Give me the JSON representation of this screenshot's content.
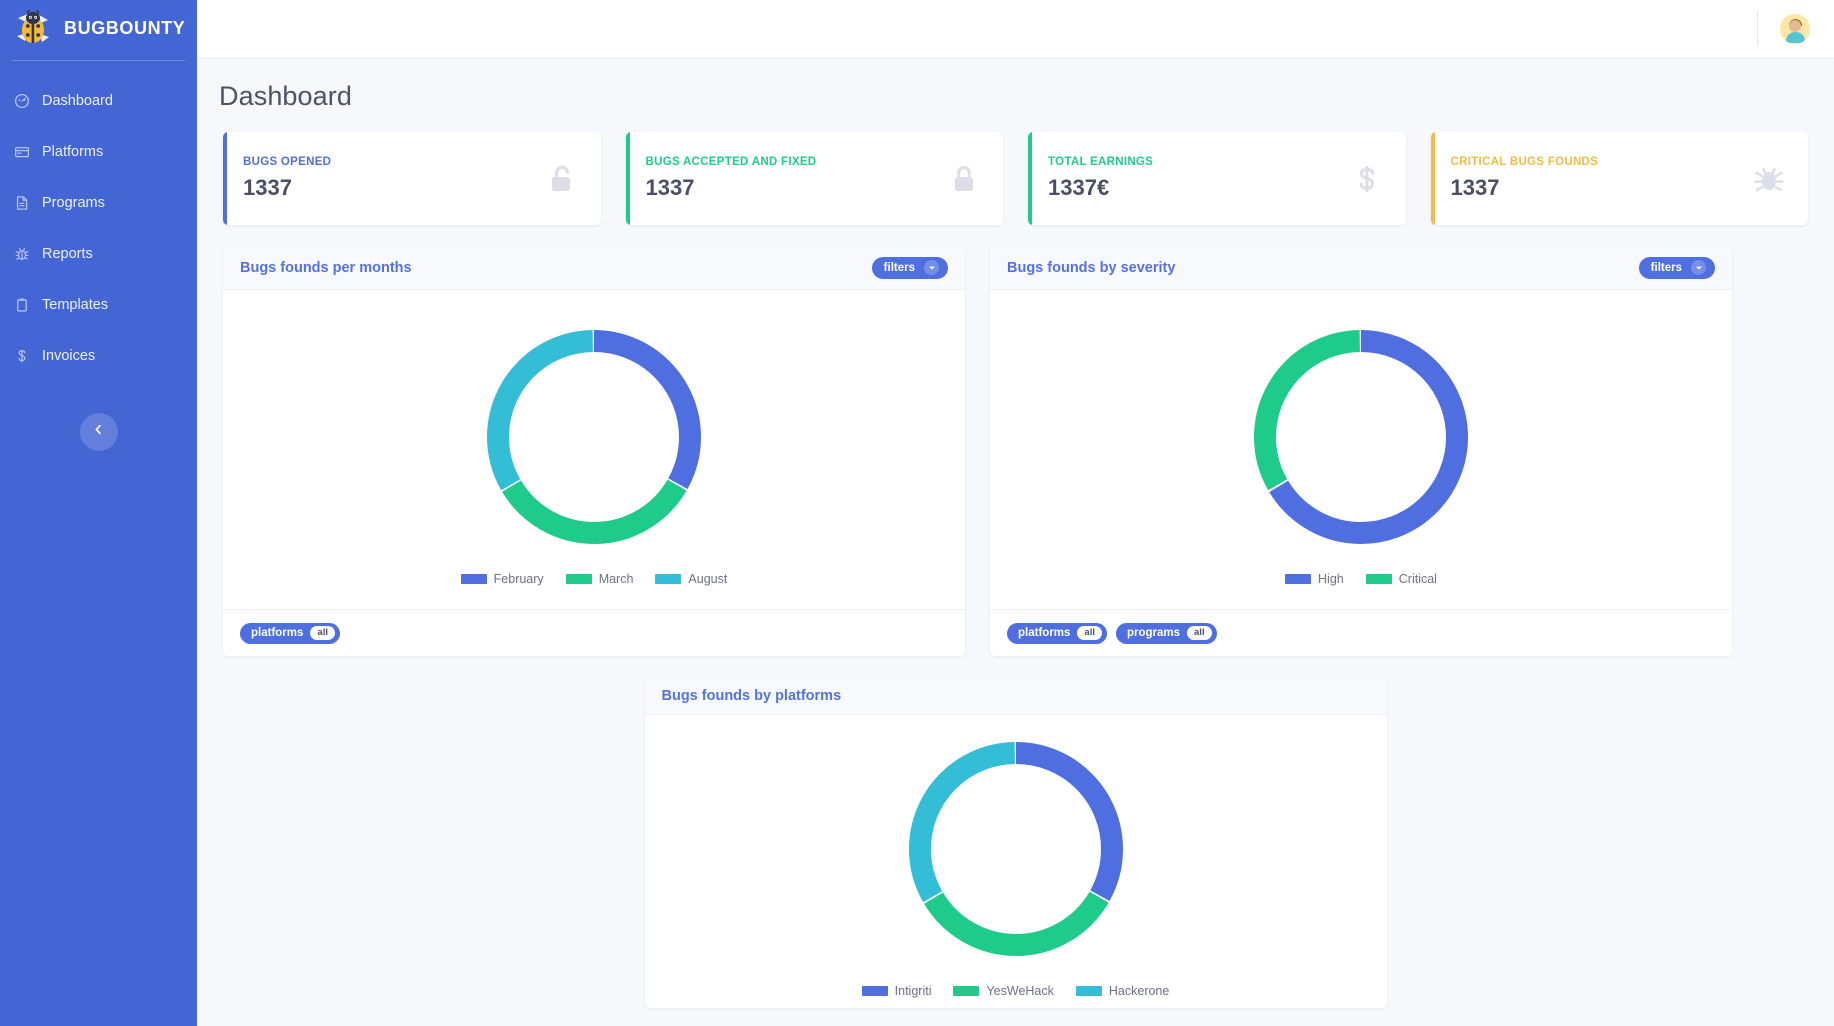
{
  "brand": {
    "name": "BUGBOUNTY",
    "logo_icon": "ladybug-logo-icon"
  },
  "sidebar": {
    "items": [
      {
        "label": "Dashboard",
        "icon": "speedometer-icon"
      },
      {
        "label": "Platforms",
        "icon": "browser-window-icon"
      },
      {
        "label": "Programs",
        "icon": "document-icon"
      },
      {
        "label": "Reports",
        "icon": "bug-icon"
      },
      {
        "label": "Templates",
        "icon": "clipboard-icon"
      },
      {
        "label": "Invoices",
        "icon": "dollar-icon"
      }
    ],
    "collapse_icon": "chevron-left-icon"
  },
  "topbar": {
    "avatar_icon": "user-avatar-icon"
  },
  "page": {
    "title": "Dashboard"
  },
  "stats": [
    {
      "label": "BUGS OPENED",
      "value": "1337",
      "accent": "#4f6fe0",
      "label_color": "#4f6fe0",
      "icon": "unlock-icon"
    },
    {
      "label": "BUGS ACCEPTED AND FIXED",
      "value": "1337",
      "accent": "#1ecb8b",
      "label_color": "#1ecb8b",
      "icon": "lock-icon"
    },
    {
      "label": "TOTAL EARNINGS",
      "value": "1337€",
      "accent": "#1ecb8b",
      "label_color": "#1ecb8b",
      "icon": "dollar-sign-icon"
    },
    {
      "label": "CRITICAL BUGS FOUNDS",
      "value": "1337",
      "accent": "#f3bb45",
      "label_color": "#f3bb45",
      "icon": "bug-icon"
    }
  ],
  "cards": {
    "months": {
      "title": "Bugs founds per months",
      "filters_label": "filters",
      "footer_pills": [
        {
          "label": "platforms",
          "badge": "all"
        }
      ]
    },
    "severity": {
      "title": "Bugs founds by severity",
      "filters_label": "filters",
      "footer_pills": [
        {
          "label": "platforms",
          "badge": "all"
        },
        {
          "label": "programs",
          "badge": "all"
        }
      ]
    },
    "platforms": {
      "title": "Bugs founds by platforms",
      "footer_pills": []
    }
  },
  "chart_data": [
    {
      "type": "pie",
      "id": "bugs-per-months",
      "title": "Bugs founds per months",
      "donut": true,
      "legend_position": "bottom",
      "categories": [
        "February",
        "March",
        "August"
      ],
      "values": [
        33.3,
        33.3,
        33.4
      ],
      "colors": [
        "#4f6fe0",
        "#1ecb8b",
        "#33bdd6"
      ]
    },
    {
      "type": "pie",
      "id": "bugs-by-severity",
      "title": "Bugs founds by severity",
      "donut": true,
      "legend_position": "bottom",
      "categories": [
        "High",
        "Critical"
      ],
      "values": [
        66.7,
        33.3
      ],
      "colors": [
        "#4f6fe0",
        "#1ecb8b"
      ]
    },
    {
      "type": "pie",
      "id": "bugs-by-platforms",
      "title": "Bugs founds by platforms",
      "donut": true,
      "legend_position": "bottom",
      "categories": [
        "Intigriti",
        "YesWeHack",
        "Hackerone"
      ],
      "values": [
        33.3,
        33.3,
        33.4
      ],
      "colors": [
        "#4f6fe0",
        "#1ecb8b",
        "#33bdd6"
      ]
    }
  ]
}
